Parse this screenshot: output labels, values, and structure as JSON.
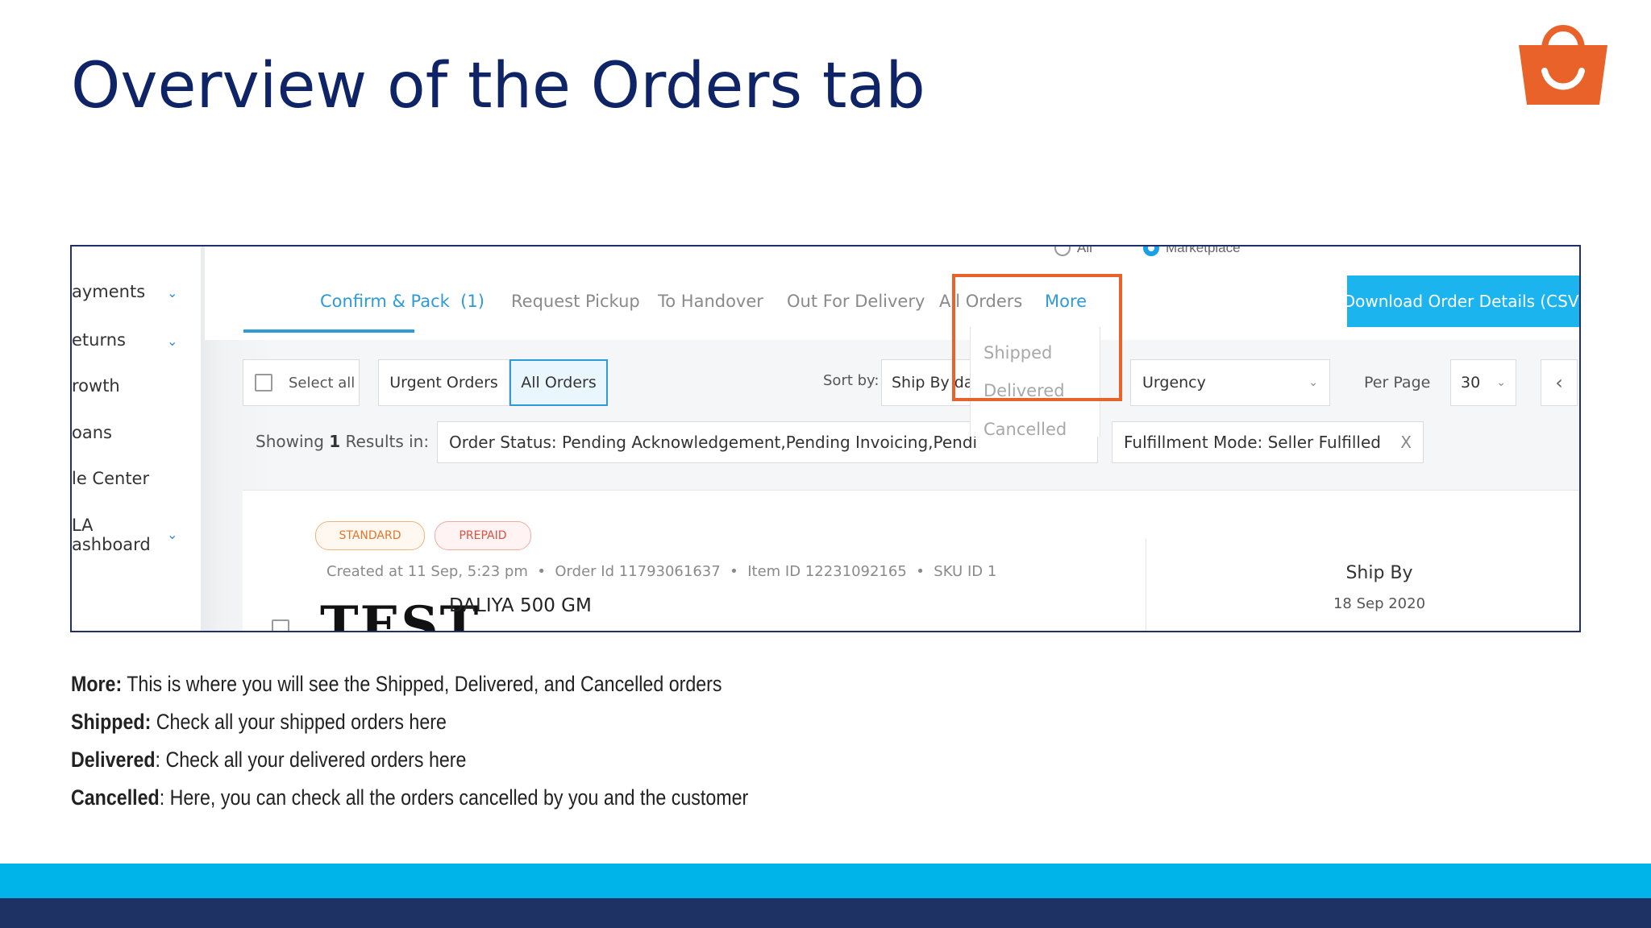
{
  "slide": {
    "title": "Overview of the Orders tab",
    "colors": {
      "title": "#0f2466",
      "accent_orange": "#e8622a",
      "cyan": "#00b4ea",
      "navy": "#1e3264"
    },
    "logo_icon": "shopping-bag-icon"
  },
  "sidebar": {
    "items": [
      {
        "label": "ayments",
        "chevron": true
      },
      {
        "label": "eturns",
        "chevron": true
      },
      {
        "label": "rowth",
        "chevron": false
      },
      {
        "label": "oans",
        "chevron": false
      },
      {
        "label": "le Center",
        "chevron": false
      },
      {
        "label": "LA",
        "chevron": false
      },
      {
        "label": "ashboard",
        "chevron": true
      }
    ]
  },
  "channel_filter": {
    "options": [
      "All",
      "Marketplace"
    ],
    "selected": "Marketplace"
  },
  "tabs": {
    "confirm_pack": "Confirm & Pack",
    "confirm_pack_count": "(1)",
    "request_pickup": "Request Pickup",
    "to_handover": "To Handover",
    "out_for_delivery": "Out For Delivery",
    "all_orders": "All Orders",
    "more": "More"
  },
  "more_menu": {
    "items": [
      "Shipped",
      "Delivered",
      "Cancelled"
    ]
  },
  "download_button": "Download Order Details (CSV)",
  "toolbar": {
    "select_all": "Select all",
    "urgent_orders": "Urgent Orders",
    "all_orders": "All Orders",
    "sort_by_label": "Sort by:",
    "sort_by_value": "Ship By da",
    "urgency": "Urgency",
    "per_page_label": "Per Page",
    "per_page_value": "30"
  },
  "results": {
    "showing_prefix": "Showing",
    "count": "1",
    "showing_suffix": "Results in:",
    "status_filter": "Order Status: Pending Acknowledgement,Pending Invoicing,Pendi",
    "fulfillment_filter": "Fulfillment Mode: Seller Fulfilled",
    "clear": "X"
  },
  "order": {
    "tags": [
      "STANDARD",
      "PREPAID"
    ],
    "created": "Created at 11 Sep, 5:23 pm",
    "order_id": "Order Id 11793061637",
    "item_id": "Item ID 12231092165",
    "sku_id": "SKU ID 1",
    "brand_image_text": "TEST",
    "product_name": "DALIYA 500 GM",
    "ship_by_label": "Ship By",
    "ship_by_date": "18 Sep 2020"
  },
  "notes": [
    {
      "term": "More:",
      "text": " This is where you will see the Shipped, Delivered, and  Cancelled orders"
    },
    {
      "term": "Shipped:",
      "text": " Check all your shipped orders here"
    },
    {
      "term": "Delivered",
      "text": ": Check all your delivered orders here"
    },
    {
      "term": "Cancelled",
      "text": ": Here, you can check all the orders cancelled by you and the customer"
    }
  ]
}
